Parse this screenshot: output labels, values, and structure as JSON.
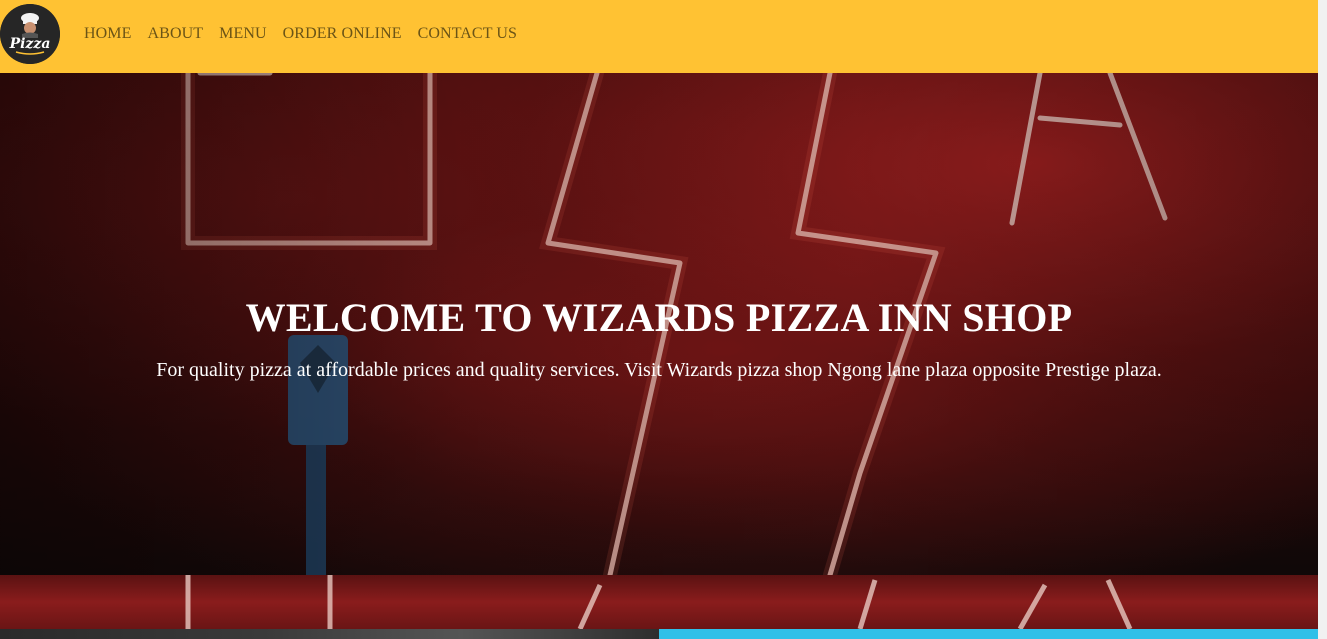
{
  "nav": {
    "logo_text": "Pizza",
    "links": [
      {
        "label": "HOME"
      },
      {
        "label": "ABOUT"
      },
      {
        "label": "MENU"
      },
      {
        "label": "ORDER ONLINE"
      },
      {
        "label": "CONTACT US"
      }
    ]
  },
  "hero": {
    "title": "WELCOME TO WIZARDS PIZZA INN SHOP",
    "subtitle": "For quality pizza at affordable prices and quality services. Visit Wizards pizza shop Ngong lane plaza opposite Prestige plaza.",
    "background_icon": "neon-pizza-sign-image"
  },
  "colors": {
    "nav_bg": "#ffc233",
    "nav_link": "#6b5416",
    "hero_text": "#ffffff",
    "accent_blue": "#2fc0e8"
  }
}
